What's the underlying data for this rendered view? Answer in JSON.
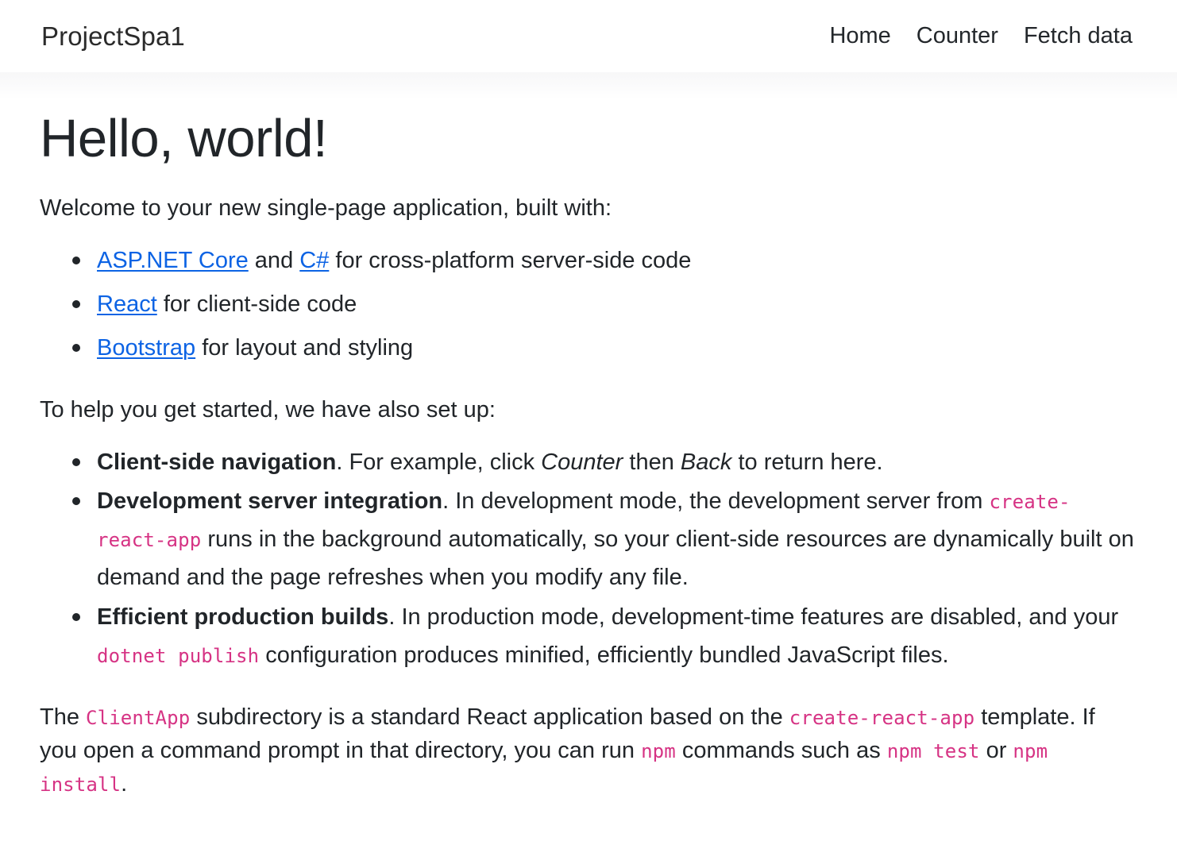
{
  "navbar": {
    "brand": "ProjectSpa1",
    "links": [
      {
        "label": "Home",
        "name": "nav-link-home"
      },
      {
        "label": "Counter",
        "name": "nav-link-counter"
      },
      {
        "label": "Fetch data",
        "name": "nav-link-fetch-data"
      }
    ]
  },
  "main": {
    "heading": "Hello, world!",
    "intro": "Welcome to your new single-page application, built with:",
    "tech_list": [
      {
        "link1": "ASP.NET Core",
        "mid": " and ",
        "link2": "C#",
        "tail": " for cross-platform server-side code"
      },
      {
        "link1": "React",
        "tail": " for client-side code"
      },
      {
        "link1": "Bootstrap",
        "tail": " for layout and styling"
      }
    ],
    "setup_intro": "To help you get started, we have also set up:",
    "features": [
      {
        "title": "Client-side navigation",
        "part1": ". For example, click ",
        "em1": "Counter",
        "part2": " then ",
        "em2": "Back",
        "part3": " to return here."
      },
      {
        "title": "Development server integration",
        "part1": ". In development mode, the development server from ",
        "code1": "create-react-app",
        "part2": " runs in the background automatically, so your client-side resources are dynamically built on demand and the page refreshes when you modify any file."
      },
      {
        "title": "Efficient production builds",
        "part1": ". In production mode, development-time features are disabled, and your ",
        "code1": "dotnet publish",
        "part2": " configuration produces minified, efficiently bundled JavaScript files."
      }
    ],
    "closing": {
      "p1": "The ",
      "code1": "ClientApp",
      "p2": " subdirectory is a standard React application based on the ",
      "code2": "create-react-app",
      "p3": " template. If you open a command prompt in that directory, you can run ",
      "code3": "npm",
      "p4": " commands such as ",
      "code4": "npm test",
      "p5": " or ",
      "code5": "npm install",
      "p6": "."
    }
  },
  "colors": {
    "link": "#0c63e4",
    "code": "#d63384",
    "text": "#212529",
    "border": "#e3e5e8"
  }
}
